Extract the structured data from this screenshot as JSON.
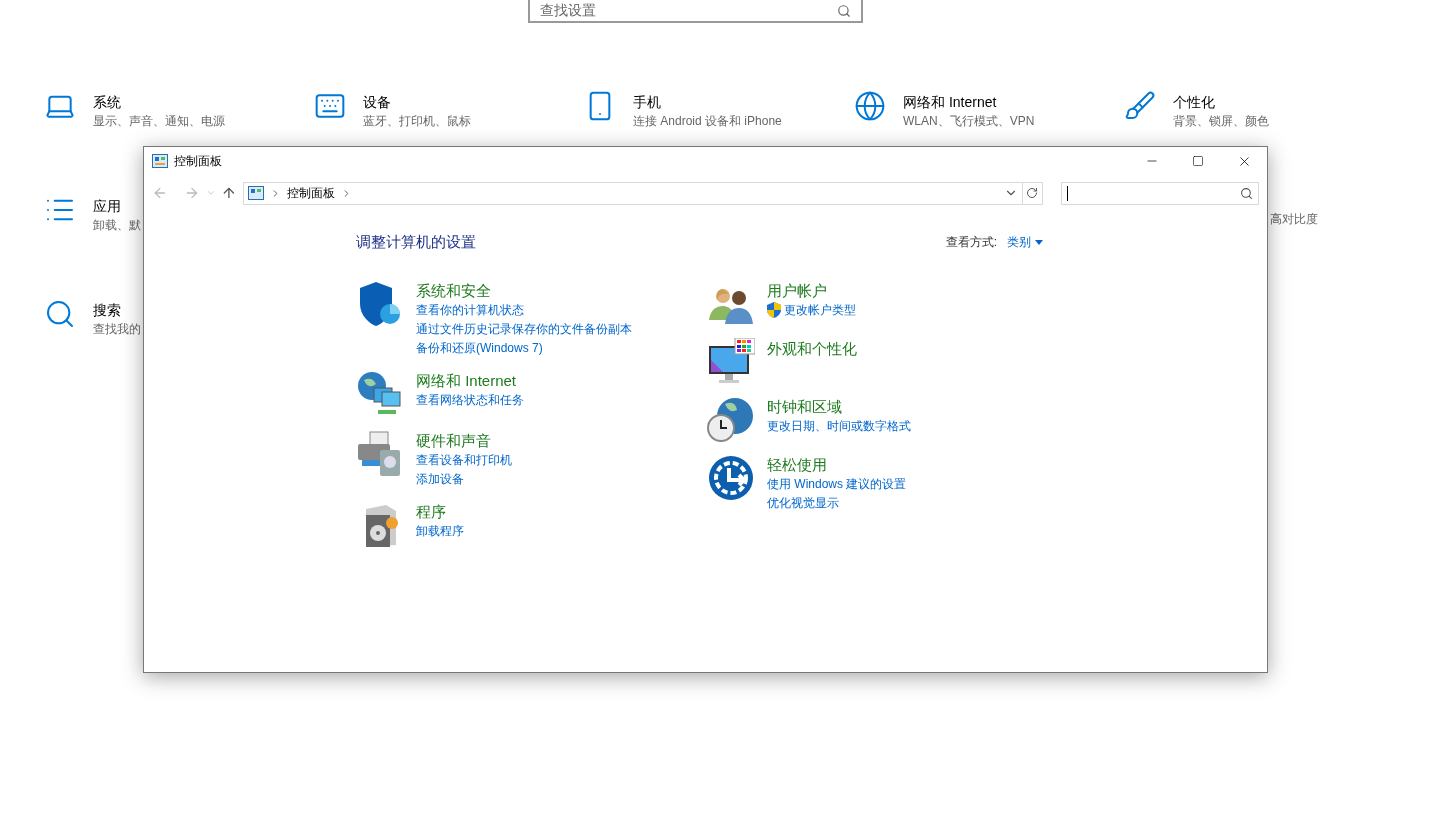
{
  "settings": {
    "search": {
      "placeholder": "查找设置"
    },
    "rows": [
      [
        {
          "kind": "laptop",
          "title": "系统",
          "description": "显示、声音、通知、电源"
        },
        {
          "kind": "keyboard",
          "title": "设备",
          "description": "蓝牙、打印机、鼠标"
        },
        {
          "kind": "phone",
          "title": "手机",
          "description": "连接 Android 设备和 iPhone"
        },
        {
          "kind": "globe",
          "title": "网络和 Internet",
          "description": "WLAN、飞行模式、VPN"
        },
        {
          "kind": "brush",
          "title": "个性化",
          "description": "背景、锁屏、颜色"
        }
      ],
      [
        {
          "kind": "apps",
          "title": "应用",
          "description": "卸载、默"
        },
        {
          "kind": "fragment",
          "description": "高对比度"
        }
      ],
      [
        {
          "kind": "search",
          "title": "搜索",
          "description": "查找我的"
        }
      ]
    ]
  },
  "window": {
    "title": "控制面板",
    "address": [
      "控制面板"
    ],
    "heading": "调整计算机的设置",
    "view_by": {
      "label": "查看方式:",
      "value": "类别"
    },
    "columns": [
      [
        {
          "kind": "security",
          "title": "系统和安全",
          "links": [
            {
              "text": "查看你的计算机状态",
              "shield": false
            },
            {
              "text": "通过文件历史记录保存你的文件备份副本",
              "shield": false
            },
            {
              "text": "备份和还原(Windows 7)",
              "shield": false
            }
          ]
        },
        {
          "kind": "network",
          "title": "网络和 Internet",
          "links": [
            {
              "text": "查看网络状态和任务",
              "shield": false
            }
          ]
        },
        {
          "kind": "hardware",
          "title": "硬件和声音",
          "links": [
            {
              "text": "查看设备和打印机",
              "shield": false
            },
            {
              "text": "添加设备",
              "shield": false
            }
          ]
        },
        {
          "kind": "programs",
          "title": "程序",
          "links": [
            {
              "text": "卸载程序",
              "shield": false
            }
          ]
        }
      ],
      [
        {
          "kind": "users",
          "title": "用户帐户",
          "links": [
            {
              "text": "更改帐户类型",
              "shield": true
            }
          ]
        },
        {
          "kind": "appearance",
          "title": "外观和个性化"
        },
        {
          "kind": "clock",
          "title": "时钟和区域",
          "links": [
            {
              "text": "更改日期、时间或数字格式",
              "shield": false
            }
          ]
        },
        {
          "kind": "ease",
          "title": "轻松使用",
          "links": [
            {
              "text": "使用 Windows 建议的设置",
              "shield": false
            },
            {
              "text": "优化视觉显示",
              "shield": false
            }
          ]
        }
      ]
    ]
  }
}
